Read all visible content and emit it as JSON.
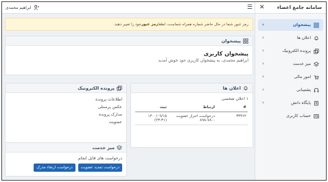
{
  "sidebar": {
    "title": "سامانه جامع اعضاء",
    "items": [
      {
        "label": "پیشخوان",
        "icon": "grid-icon",
        "active": true
      },
      {
        "label": "اعلان ها",
        "icon": "bell-icon",
        "active": false
      },
      {
        "label": "پرونده الکترونیک",
        "icon": "folders-icon",
        "active": false
      },
      {
        "label": "میز خدمت",
        "icon": "layers-icon",
        "active": false
      },
      {
        "label": "امور مالی",
        "icon": "cart-icon",
        "active": false
      },
      {
        "label": "پشتیبانی",
        "icon": "headset-icon",
        "active": false
      },
      {
        "label": "پایگاه دانش",
        "icon": "knowledge-icon",
        "active": false
      },
      {
        "label": "حساب کاربری",
        "icon": "id-card-icon",
        "active": false
      }
    ]
  },
  "topbar": {
    "user_name": "ابراهیم محمدی"
  },
  "alert": {
    "text_before": "رمز عبور شما در حال حاضر شماره همراه شماست، لطفا ",
    "bold": "رمز عبور",
    "text_after": " خود را تغییر دهید."
  },
  "dashboard": {
    "header": "پیشخوان",
    "title": "پیشخوان کاربری",
    "welcome": "ابراهیم محمدی، به پیشخوان کاربری خود خوش آمدید"
  },
  "documents": {
    "header": "پرونده الکترونیک",
    "items": [
      "اطلاعات پرونده",
      "عکس پرسنلی",
      "مدارک پرونده",
      "عضویت"
    ]
  },
  "announcements": {
    "header": "اعلان ها",
    "subtitle": "۱ اعلان شخصی",
    "columns": [
      "#",
      "ارتباط",
      "ثبت"
    ],
    "rows": [
      {
        "id": "۳۳۳۶۲",
        "relation": "درخواست احراز عضویت -۷۸۰-۸۹۸",
        "date": "۱۴۰۰/۰۹/۱۵ (۲۳:۳۱)"
      }
    ]
  },
  "service": {
    "header": "میز خدمت",
    "subtitle": "درخواست های قابل انجام",
    "buttons": [
      "درخواست تمدید عضویت",
      "درخواست ارتقاء مدرک"
    ]
  },
  "colors": {
    "primary": "#1f66b5",
    "active_bg": "#dbe7f5",
    "alert_bg": "#fff6d9"
  }
}
